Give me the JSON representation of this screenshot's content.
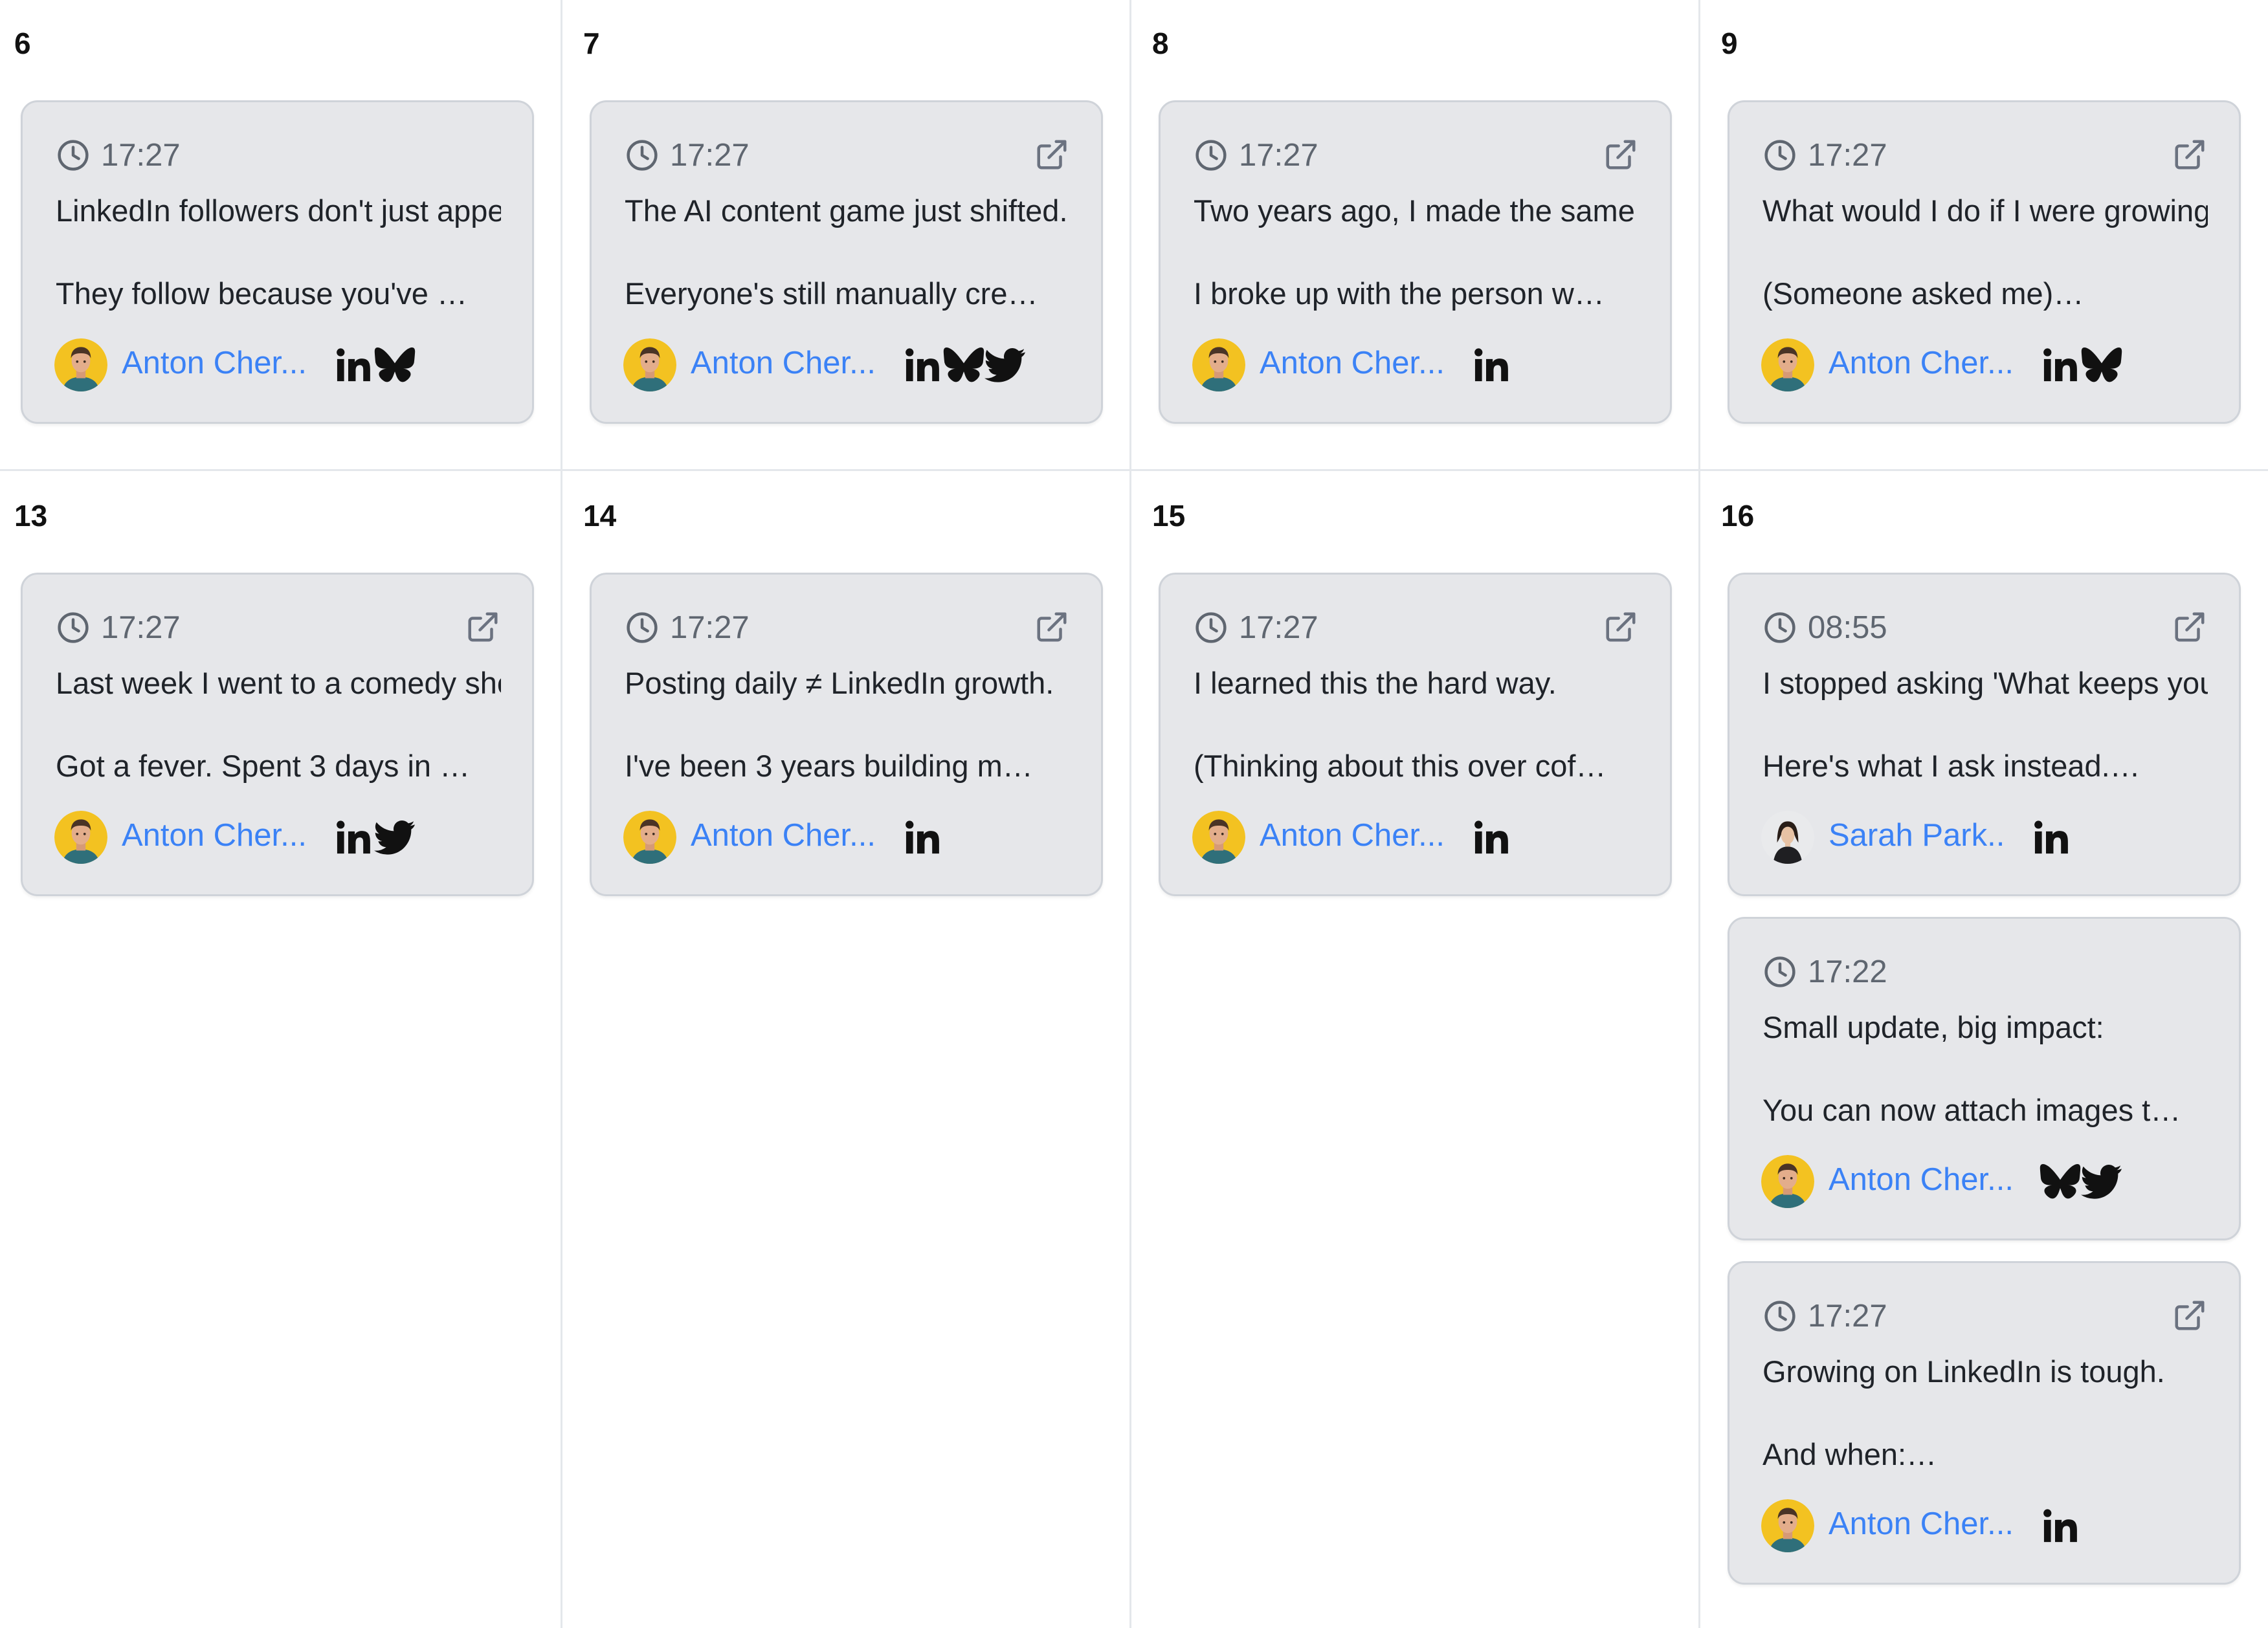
{
  "days": [
    {
      "day": "6",
      "posts": [
        {
          "time": "17:27",
          "open_link": false,
          "line1": "LinkedIn followers don't just appear.",
          "line2": "They follow because you've …",
          "author": "Anton Cher...",
          "author_avatar": "anton-avatar",
          "networks": [
            "linkedin",
            "bluesky"
          ]
        }
      ]
    },
    {
      "day": "7",
      "posts": [
        {
          "time": "17:27",
          "open_link": true,
          "line1": "The AI content game just shifted.",
          "line2": "Everyone's still manually cre…",
          "author": "Anton Cher...",
          "author_avatar": "anton-avatar",
          "networks": [
            "linkedin",
            "bluesky",
            "twitter"
          ]
        }
      ]
    },
    {
      "day": "8",
      "posts": [
        {
          "time": "17:27",
          "open_link": true,
          "line1": "Two years ago, I made the same mistake.",
          "line2": "I broke up with the person w…",
          "author": "Anton Cher...",
          "author_avatar": "anton-avatar",
          "networks": [
            "linkedin"
          ]
        }
      ]
    },
    {
      "day": "9",
      "posts": [
        {
          "time": "17:27",
          "open_link": true,
          "line1": "What would I do if I were growing on LinkedIn?",
          "line2": "(Someone asked me)…",
          "author": "Anton Cher...",
          "author_avatar": "anton-avatar",
          "networks": [
            "linkedin",
            "bluesky"
          ]
        }
      ]
    },
    {
      "day": "13",
      "posts": [
        {
          "time": "17:27",
          "open_link": true,
          "line1": "Last week I went to a comedy show.",
          "line2": "Got a fever. Spent 3 days in …",
          "author": "Anton Cher...",
          "author_avatar": "anton-avatar",
          "networks": [
            "linkedin",
            "twitter"
          ]
        }
      ]
    },
    {
      "day": "14",
      "posts": [
        {
          "time": "17:27",
          "open_link": true,
          "line1": "Posting daily ≠ LinkedIn growth.",
          "line2": "I've been 3 years building m…",
          "author": "Anton Cher...",
          "author_avatar": "anton-avatar",
          "networks": [
            "linkedin"
          ]
        }
      ]
    },
    {
      "day": "15",
      "posts": [
        {
          "time": "17:27",
          "open_link": true,
          "line1": "I learned this the hard way.",
          "line2": "(Thinking about this over cof…",
          "author": "Anton Cher...",
          "author_avatar": "anton-avatar",
          "networks": [
            "linkedin"
          ]
        }
      ]
    },
    {
      "day": "16",
      "posts": [
        {
          "time": "08:55",
          "open_link": true,
          "line1": "I stopped asking 'What keeps you up at night?'",
          "line2": "Here's what I ask instead.…",
          "author": "Sarah Park..",
          "author_avatar": "sarah-avatar",
          "networks": [
            "linkedin"
          ]
        },
        {
          "time": "17:22",
          "open_link": false,
          "line1": "Small update, big impact:",
          "line2": "You can now attach images t…",
          "author": "Anton Cher...",
          "author_avatar": "anton-avatar",
          "networks": [
            "bluesky",
            "twitter"
          ]
        },
        {
          "time": "17:27",
          "open_link": true,
          "line1": "Growing on LinkedIn is tough.",
          "line2": "And when:…",
          "author": "Anton Cher...",
          "author_avatar": "anton-avatar",
          "networks": [
            "linkedin"
          ]
        }
      ]
    }
  ]
}
